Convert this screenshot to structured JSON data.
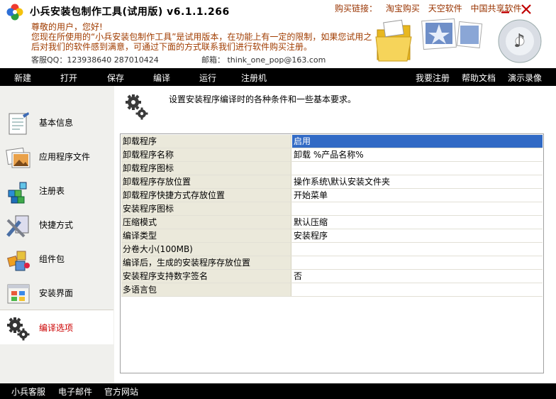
{
  "header": {
    "title": "小兵安装包制作工具(试用版) v6.1.1.266",
    "buy_label": "购买链接：",
    "buy_links": [
      "淘宝购买",
      "天空软件",
      "中国共享软件"
    ],
    "notice_line1": "尊敬的用户，您好!",
    "notice_line2": "您现在所使用的“小兵安装包制作工具”是试用版本，在功能上有一定的限制，如果您试用之后对我们的软件感到满意，可通过下面的方式联系我们进行软件购买注册。",
    "qq": "客服QQ：123938640  287010424",
    "email": "邮箱： think_one_pop@163.com"
  },
  "menubar": {
    "left": [
      "新建",
      "打开",
      "保存",
      "编译",
      "运行",
      "注册机"
    ],
    "right": [
      "我要注册",
      "帮助文档",
      "演示录像"
    ]
  },
  "sidebar": {
    "items": [
      {
        "label": "基本信息",
        "icon": "notepad-icon"
      },
      {
        "label": "应用程序文件",
        "icon": "image-files-icon"
      },
      {
        "label": "注册表",
        "icon": "registry-cubes-icon"
      },
      {
        "label": "快捷方式",
        "icon": "shortcut-tools-icon"
      },
      {
        "label": "组件包",
        "icon": "components-icon"
      },
      {
        "label": "安装界面",
        "icon": "install-ui-icon"
      },
      {
        "label": "编译选项",
        "icon": "gears-icon"
      }
    ],
    "active_index": 6
  },
  "content": {
    "description": "设置安装程序编译时的各种条件和一些基本要求。",
    "rows": [
      {
        "key": "卸载程序",
        "value": "启用"
      },
      {
        "key": "卸载程序名称",
        "value": "卸载 %产品名称%"
      },
      {
        "key": "卸载程序图标",
        "value": ""
      },
      {
        "key": "卸载程序存放位置",
        "value": "操作系统\\默认安装文件夹"
      },
      {
        "key": "卸载程序快捷方式存放位置",
        "value": "开始菜单"
      },
      {
        "key": "安装程序图标",
        "value": ""
      },
      {
        "key": "压缩模式",
        "value": "默认压缩"
      },
      {
        "key": "编译类型",
        "value": "安装程序"
      },
      {
        "key": "分卷大小(100MB)",
        "value": ""
      },
      {
        "key": "编译后，生成的安装程序存放位置",
        "value": ""
      },
      {
        "key": "安装程序支持数字签名",
        "value": "否"
      },
      {
        "key": "多语言包",
        "value": ""
      }
    ],
    "selected_row": 0
  },
  "footer": {
    "links": [
      "小兵客服",
      "电子邮件",
      "官方网站"
    ]
  },
  "colors": {
    "menubar_bg": "#000000",
    "notice_text": "#a03c00",
    "active_nav_text": "#cc0000",
    "selection": "#316ac5",
    "key_cell_bg": "#ebe9db"
  }
}
